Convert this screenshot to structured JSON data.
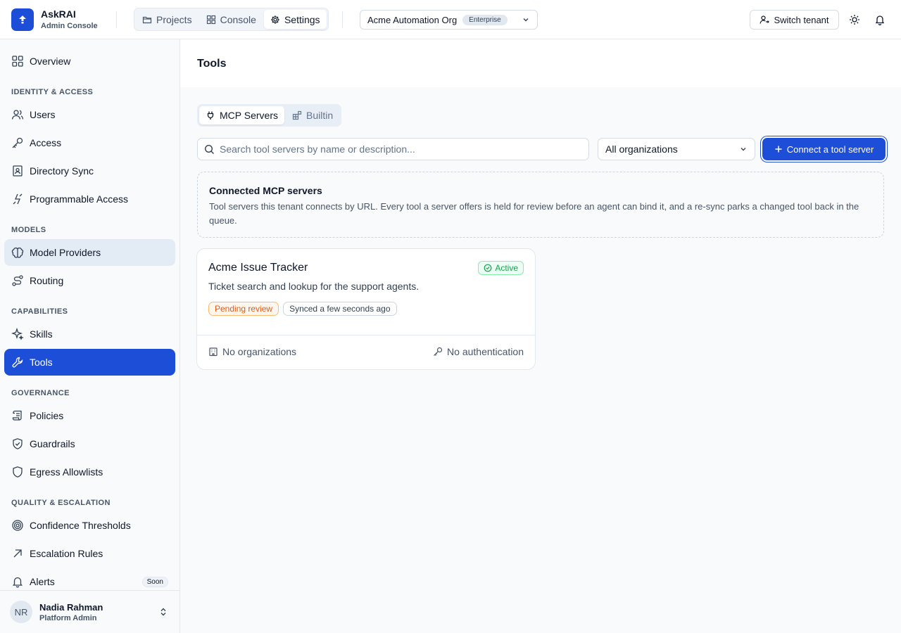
{
  "brand": {
    "name": "AskRAI",
    "subtitle": "Admin Console",
    "accent": "#1d4ed8"
  },
  "top_nav": [
    {
      "label": "Projects",
      "icon": "folder-icon",
      "active": false
    },
    {
      "label": "Console",
      "icon": "grid-icon",
      "active": false
    },
    {
      "label": "Settings",
      "icon": "gear-icon",
      "active": true
    }
  ],
  "org_selector": {
    "value": "Acme Automation Org",
    "badge": "Enterprise"
  },
  "header_actions": {
    "switch_tenant": "Switch tenant"
  },
  "sidebar": {
    "overview": "Overview",
    "sections": [
      {
        "heading": "IDENTITY & ACCESS",
        "items": [
          "Users",
          "Access",
          "Directory Sync",
          "Programmable Access"
        ]
      },
      {
        "heading": "MODELS",
        "items": [
          "Model Providers",
          "Routing"
        ]
      },
      {
        "heading": "CAPABILITIES",
        "items": [
          "Skills",
          "Tools"
        ]
      },
      {
        "heading": "GOVERNANCE",
        "items": [
          "Policies",
          "Guardrails",
          "Egress Allowlists"
        ]
      },
      {
        "heading": "QUALITY & ESCALATION",
        "items": [
          "Confidence Thresholds",
          "Escalation Rules",
          "Alerts"
        ]
      }
    ],
    "alerts_badge": "Soon",
    "active_item": "Tools",
    "hover_item": "Model Providers"
  },
  "user": {
    "initials": "NR",
    "name": "Nadia Rahman",
    "role": "Platform Admin"
  },
  "page": {
    "title": "Tools",
    "tabs": [
      {
        "label": "MCP Servers",
        "active": true
      },
      {
        "label": "Builtin",
        "active": false
      }
    ],
    "search_placeholder": "Search tool servers by name or description...",
    "org_filter": "All organizations",
    "connect_button": "Connect a tool server",
    "info": {
      "title": "Connected MCP servers",
      "description": "Tool servers this tenant connects by URL. Every tool a server offers is held for review before an agent can bind it, and a re-sync parks a changed tool back in the queue."
    },
    "servers": [
      {
        "name": "Acme Issue Tracker",
        "status": "Active",
        "description": "Ticket search and lookup for the support agents.",
        "review_badge": "Pending review",
        "sync_badge": "Synced a few seconds ago",
        "organizations": "No organizations",
        "auth": "No authentication"
      }
    ]
  },
  "colors": {
    "primary": "#1d4ed8",
    "success": "#16a34a",
    "warning": "#ea580c"
  }
}
